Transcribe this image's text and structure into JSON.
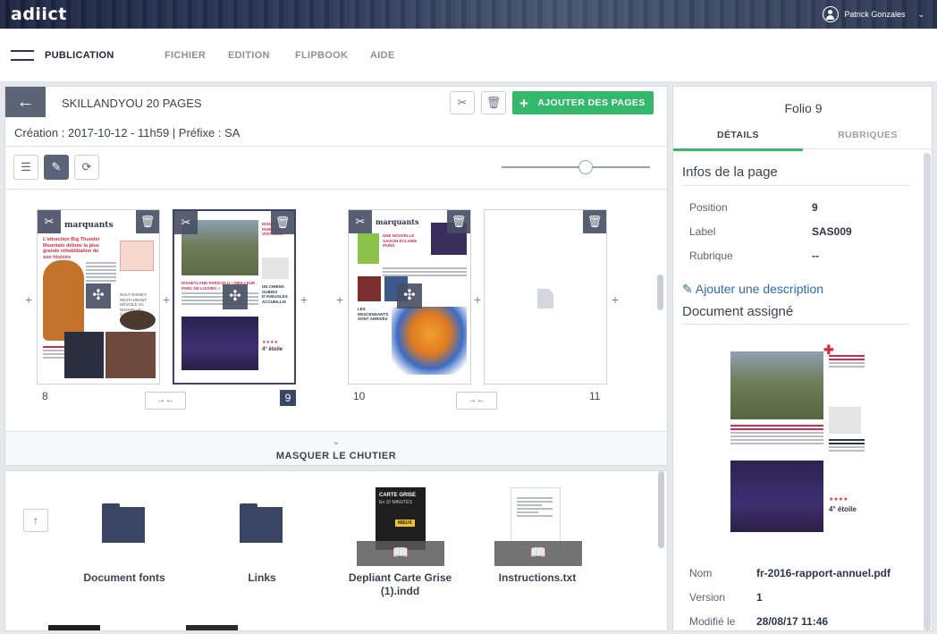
{
  "app": {
    "logo": "adiict",
    "user_name": "Patrick Gonzales"
  },
  "menu": {
    "publication": "PUBLICATION",
    "items": [
      "FICHIER",
      "EDITION",
      "FLIPBOOK",
      "AIDE"
    ]
  },
  "document": {
    "title": "SKILLANDYOU  20 PAGES",
    "meta": "Création : 2017-10-12 - 11h59 | Préfixe : SA",
    "add_pages_label": "AJOUTER DES PAGES"
  },
  "pages": [
    {
      "number": "8",
      "header": "marquants",
      "headline": "L'attraction Big Thunder Mountain débute la plus grande réhabilitation de son histoire"
    },
    {
      "number": "9",
      "selected": true
    },
    {
      "number": "10",
      "header": "marquants"
    },
    {
      "number": "11",
      "blank": true
    }
  ],
  "hide_tray_label": "MASQUER LE CHUTIER",
  "tray": {
    "items": [
      {
        "type": "folder",
        "label": "Document fonts"
      },
      {
        "type": "folder",
        "label": "Links"
      },
      {
        "type": "file",
        "label": "Depliant Carte Grise (1).indd",
        "thumb_title": "CARTE GRISE",
        "thumb_sub": "En 10 MINUTES",
        "thumb_badge": "MIEUX"
      },
      {
        "type": "file",
        "label": "Instructions.txt"
      }
    ]
  },
  "right": {
    "folio": "Folio 9",
    "tabs": [
      "DÉTAILS",
      "RUBRIQUES"
    ],
    "infos_title": "Infos de la page",
    "props": [
      {
        "k": "Position",
        "v": "9"
      },
      {
        "k": "Label",
        "v": "SAS009"
      },
      {
        "k": "Rubrique",
        "v": "--"
      }
    ],
    "add_description": "Ajouter une description",
    "assigned_title": "Document assigné",
    "doc_meta": [
      {
        "k": "Nom",
        "v": "fr-2016-rapport-annuel.pdf"
      },
      {
        "k": "Version",
        "v": "1"
      },
      {
        "k": "Modifié le",
        "v": "28/08/17 11:46"
      }
    ]
  },
  "colors": {
    "accent_green": "#34b86c",
    "dark_slate": "#3a4666",
    "link_blue": "#2f6aa8",
    "brand_red": "#d42b4a"
  }
}
